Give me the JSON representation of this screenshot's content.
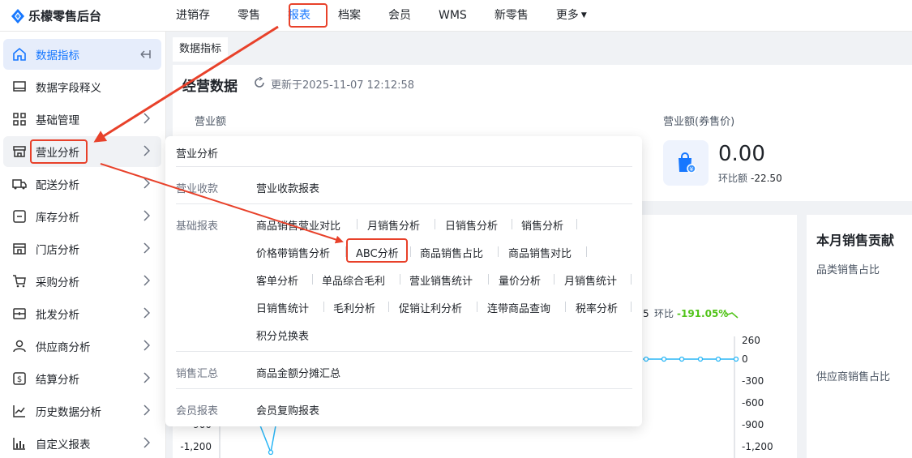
{
  "app": {
    "title": "乐檬零售后台"
  },
  "topnav": [
    {
      "label": "进销存"
    },
    {
      "label": "零售"
    },
    {
      "label": "报表"
    },
    {
      "label": "档案"
    },
    {
      "label": "会员"
    },
    {
      "label": "WMS"
    },
    {
      "label": "新零售"
    },
    {
      "label": "更多"
    }
  ],
  "sidebar": {
    "items": [
      {
        "label": "数据指标",
        "icon": "home-icon"
      },
      {
        "label": "数据字段释义",
        "icon": "monitor-icon"
      },
      {
        "label": "基础管理",
        "icon": "grid-icon"
      },
      {
        "label": "营业分析",
        "icon": "store-icon"
      },
      {
        "label": "配送分析",
        "icon": "truck-icon"
      },
      {
        "label": "库存分析",
        "icon": "inventory-icon"
      },
      {
        "label": "门店分析",
        "icon": "shop-icon"
      },
      {
        "label": "采购分析",
        "icon": "cart-icon"
      },
      {
        "label": "批发分析",
        "icon": "wholesale-icon"
      },
      {
        "label": "供应商分析",
        "icon": "user-icon"
      },
      {
        "label": "结算分析",
        "icon": "currency-icon"
      },
      {
        "label": "历史数据分析",
        "icon": "line-chart-icon"
      },
      {
        "label": "自定义报表",
        "icon": "bar-chart-icon"
      }
    ]
  },
  "tab": {
    "label": "数据指标"
  },
  "overview": {
    "title": "经营数据",
    "updated": "更新于2025-11-07 12:12:58",
    "metric1_label": "营业额",
    "metric2_label": "营业额(券售价)",
    "metric2_value": "0.00",
    "metric2_cmp_label": "环比额",
    "metric2_cmp_value": "-22.50"
  },
  "chart": {
    "cmp_label": "环比",
    "cmp_value": "-191.05%",
    "cmp_prefix": "5",
    "right_ticks": [
      "260",
      "0",
      "-300",
      "-600",
      "-900",
      "-1,200"
    ],
    "left_ticks": [
      "-900",
      "-1,200"
    ]
  },
  "contribution": {
    "title": "本月销售贡献",
    "sub1": "品类销售占比",
    "sub2": "供应商销售占比"
  },
  "popover": {
    "title": "营业分析",
    "groups": [
      {
        "label": "营业收款",
        "links": [
          "营业收款报表"
        ]
      },
      {
        "label": "基础报表",
        "links": [
          "商品销售营业对比",
          "月销售分析",
          "日销售分析",
          "销售分析",
          "价格带销售分析",
          "ABC分析",
          "商品销售占比",
          "商品销售对比",
          "客单分析",
          "单品综合毛利",
          "营业销售统计",
          "量价分析",
          "月销售统计",
          "日销售统计",
          "毛利分析",
          "促销让利分析",
          "连带商品查询",
          "税率分析",
          "积分兑换表"
        ]
      },
      {
        "label": "销售汇总",
        "links": [
          "商品金额分摊汇总"
        ]
      },
      {
        "label": "会员报表",
        "links": [
          "会员复购报表"
        ]
      }
    ]
  },
  "colors": {
    "accent": "#1677ff",
    "highlight": "#e8412a",
    "positive": "#52c41a"
  }
}
